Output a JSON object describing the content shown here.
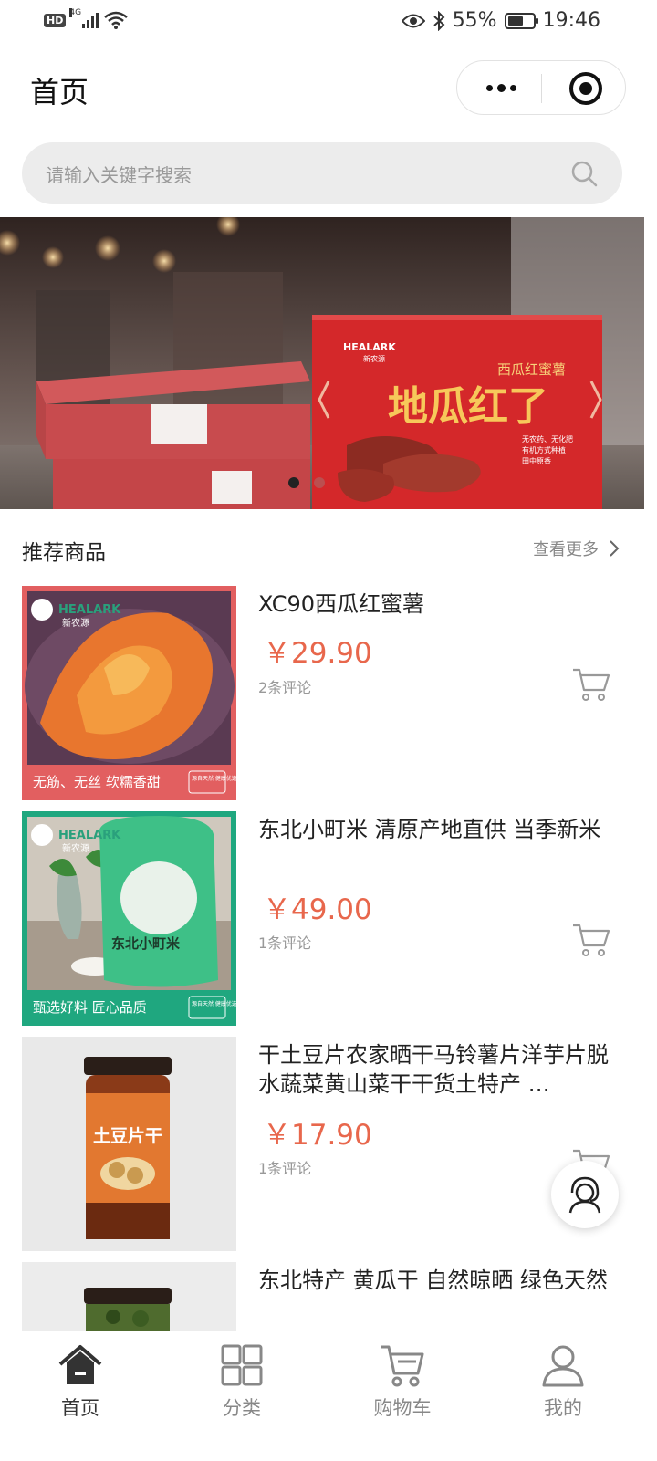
{
  "status_bar": {
    "hd": "HD",
    "network": "4G",
    "battery_percent": "55%",
    "battery_level": 0.55,
    "time": "19:46"
  },
  "nav": {
    "title": "首页"
  },
  "search": {
    "placeholder": "请输入关键字搜索"
  },
  "banner": {
    "brand": "HEALARK",
    "brand_cn": "新农源",
    "box_subtitle": "西瓜红蜜薯",
    "box_title": "地瓜红了",
    "box_tagline": [
      "无农药、无化肥",
      "有机方式种植",
      "田中原香"
    ],
    "active_slide": 1,
    "slide_count": 2
  },
  "recommend": {
    "title": "推荐商品",
    "more_label": "查看更多"
  },
  "products": [
    {
      "title": "XC90西瓜红蜜薯",
      "price": "￥29.90",
      "reviews": "2条评论",
      "thumb_brand": "HEALARK",
      "thumb_brand_cn": "新农源",
      "thumb_caption": "无筋、无丝 软糯香甜",
      "thumb_badge": "源自天然 健康优选",
      "thumb_bg": "#e15e5e"
    },
    {
      "title": "东北小町米 清原产地直供 当季新米",
      "price": "￥49.00",
      "reviews": "1条评论",
      "thumb_brand": "HEALARK",
      "thumb_brand_cn": "新农源",
      "thumb_caption": "甄选好料 匠心品质",
      "thumb_badge": "源自天然 健康优选",
      "thumb_bg": "#1fa77f",
      "bag_text": "东北小町米"
    },
    {
      "title": "干土豆片农家晒干马铃薯片洋芋片脱水蔬菜黄山菜干干货土特产 …",
      "price": "￥17.90",
      "reviews": "1条评论",
      "jar_label": "土豆片干"
    },
    {
      "title": "东北特产 黄瓜干 自然晾晒 绿色天然"
    }
  ],
  "tabbar": {
    "items": [
      {
        "label": "首页",
        "icon": "home-icon",
        "active": true
      },
      {
        "label": "分类",
        "icon": "grid-icon",
        "active": false
      },
      {
        "label": "购物车",
        "icon": "cart-icon",
        "active": false
      },
      {
        "label": "我的",
        "icon": "user-icon",
        "active": false
      }
    ]
  },
  "colors": {
    "price": "#e8674c",
    "active_tab": "#333333",
    "inactive_tab": "#888888"
  }
}
